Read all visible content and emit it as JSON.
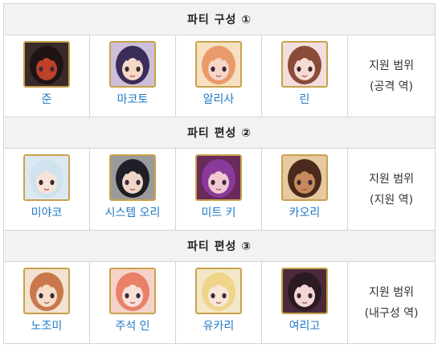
{
  "parties": [
    {
      "title": "파티 구성 ①",
      "members": [
        {
          "name": "준",
          "icon": "jun-portrait-icon",
          "colors": {
            "bg": "#3a2a2a",
            "hair": "#1e1414",
            "accent": "#c0402a"
          }
        },
        {
          "name": "마코토",
          "icon": "makoto-portrait-icon",
          "colors": {
            "bg": "#cdbfd9",
            "hair": "#3b2d5a",
            "accent": "#f4d9c6"
          }
        },
        {
          "name": "알리사",
          "icon": "alisa-portrait-icon",
          "colors": {
            "bg": "#f6e0c0",
            "hair": "#e89a6a",
            "accent": "#f6d6c8"
          }
        },
        {
          "name": "린",
          "icon": "rin-portrait-icon",
          "colors": {
            "bg": "#f2dede",
            "hair": "#8a4b3a",
            "accent": "#f6dcd0"
          }
        }
      ],
      "support_range": [
        "지원 범위",
        "(공격 역)"
      ]
    },
    {
      "title": "파티 편성 ②",
      "members": [
        {
          "name": "미야코",
          "icon": "miyako-portrait-icon",
          "colors": {
            "bg": "#dde9f2",
            "hair": "#cfe3ee",
            "accent": "#f8e3d8"
          }
        },
        {
          "name": "시스템 오리",
          "icon": "system-ori-portrait-icon",
          "colors": {
            "bg": "#9a9a9a",
            "hair": "#1e1e26",
            "accent": "#efd6c6"
          }
        },
        {
          "name": "미트 키",
          "icon": "mitoki-portrait-icon",
          "colors": {
            "bg": "#6a2a5a",
            "hair": "#8a3a9a",
            "accent": "#f2c8d0"
          }
        },
        {
          "name": "카오리",
          "icon": "kaori-portrait-icon",
          "colors": {
            "bg": "#e8c8a0",
            "hair": "#4a2a1a",
            "accent": "#c88a5a"
          }
        }
      ],
      "support_range": [
        "지원 범위",
        "(지원 역)"
      ]
    },
    {
      "title": "파티 편성 ③",
      "members": [
        {
          "name": "노조미",
          "icon": "nozomi-portrait-icon",
          "colors": {
            "bg": "#f2e2d2",
            "hair": "#c8784a",
            "accent": "#f6dcc8"
          }
        },
        {
          "name": "주석 인",
          "icon": "suzuna-portrait-icon",
          "colors": {
            "bg": "#f6d2c8",
            "hair": "#e8806a",
            "accent": "#f8e0d6"
          }
        },
        {
          "name": "유카리",
          "icon": "yukari-portrait-icon",
          "colors": {
            "bg": "#f2e8c8",
            "hair": "#f0d48a",
            "accent": "#f8e6d6"
          }
        },
        {
          "name": "여리고",
          "icon": "yorigo-portrait-icon",
          "colors": {
            "bg": "#4a2a3a",
            "hair": "#2a1a22",
            "accent": "#f4d6d2"
          }
        }
      ],
      "support_range": [
        "지원 범위",
        "(내구성 역)"
      ]
    }
  ]
}
